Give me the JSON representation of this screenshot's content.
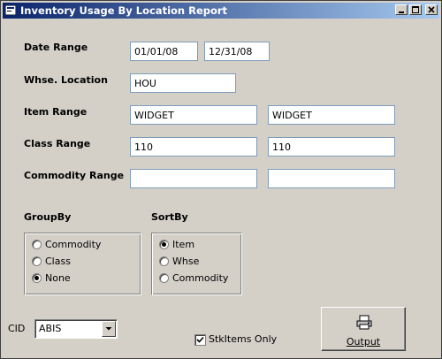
{
  "window": {
    "title": "Inventory Usage By Location Report",
    "title_colors": {
      "active_start": "#0a246a",
      "active_end": "#a6caf0"
    },
    "controls": [
      "minimize-icon",
      "maximize-icon",
      "close-icon"
    ]
  },
  "form": {
    "date_range": {
      "label": "Date Range",
      "from": "01/01/08",
      "to": "12/31/08"
    },
    "whse_location": {
      "label": "Whse. Location",
      "value": "HOU"
    },
    "item_range": {
      "label": "Item Range",
      "from": "WIDGET",
      "to": "WIDGET"
    },
    "class_range": {
      "label": "Class Range",
      "from": "110",
      "to": "110"
    },
    "commodity_range": {
      "label": "Commodity Range",
      "from": "",
      "to": ""
    }
  },
  "groupby": {
    "label": "GroupBy",
    "options": [
      "Commodity",
      "Class",
      "None"
    ],
    "selected": "None"
  },
  "sortby": {
    "label": "SortBy",
    "options": [
      "Item",
      "Whse",
      "Commodity"
    ],
    "selected": "Item"
  },
  "cid": {
    "label": "CID",
    "value": "ABIS"
  },
  "stkitems_only": {
    "label": "StkItems Only",
    "checked": true
  },
  "output_button": {
    "label": "Output",
    "icon": "printer-icon"
  }
}
